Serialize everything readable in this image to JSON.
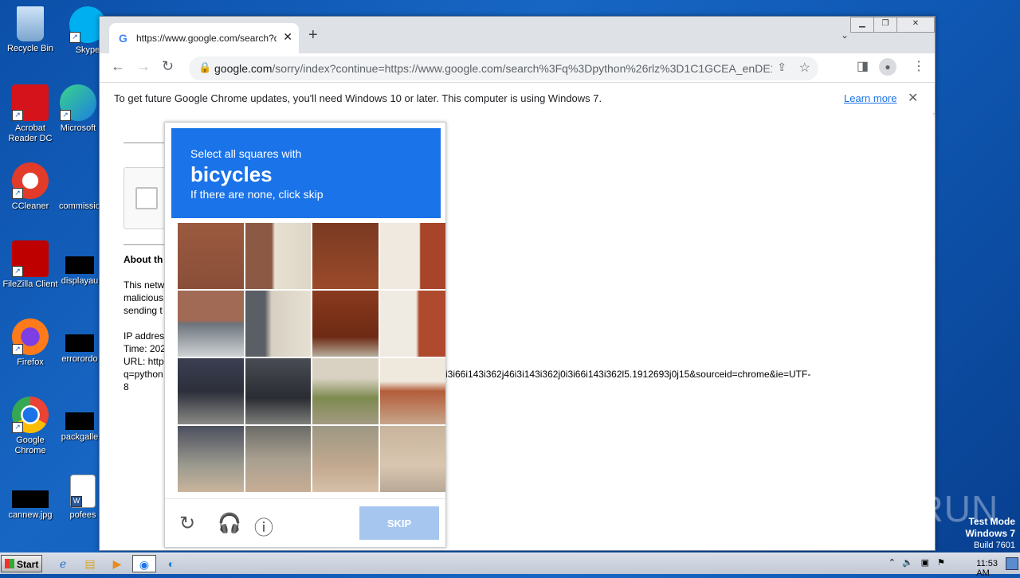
{
  "desktop": {
    "icons": [
      {
        "label": "Recycle Bin"
      },
      {
        "label": "Skype"
      },
      {
        "label": "Acrobat Reader DC"
      },
      {
        "label": "Microsoft"
      },
      {
        "label": "CCleaner"
      },
      {
        "label": "commissio"
      },
      {
        "label": "FileZilla Client"
      },
      {
        "label": "displayau"
      },
      {
        "label": "Firefox"
      },
      {
        "label": "errorordo"
      },
      {
        "label": "Google Chrome"
      },
      {
        "label": "packgalle"
      },
      {
        "label": "cannew.jpg"
      },
      {
        "label": "pofees"
      }
    ]
  },
  "browser": {
    "tab_title": "https://www.google.com/search?q=",
    "tab_close": "✕",
    "new_tab": "+",
    "url_domain": "google.com",
    "url_rest": "/sorry/index?continue=https://www.google.com/search%3Fq%3Dpython%26rlz%3D1C1GCEA_enDE1...",
    "infobar_message": "To get future Google Chrome updates, you'll need Windows 10 or later. This computer is using Windows 7.",
    "infobar_link": "Learn more"
  },
  "page": {
    "about_heading": "About th",
    "para_l1": "This netw",
    "para_l2": "malicious",
    "para_l3": "sending t",
    "ip_line": "IP addres",
    "time_line": "Time: 202",
    "url_line": "URL: http",
    "q_line": "q=python",
    "url_tail": "i3i66i143i362j46i3i143i362j0i3i66i143i362l5.1912693j0j15&sourceid=chrome&ie=UTF-",
    "url_tail2": "8"
  },
  "captcha": {
    "instruction": "Select all squares with",
    "target": "bicycles",
    "hint": "If there are none, click skip",
    "skip_label": "SKIP"
  },
  "taskbar": {
    "start_label": "Start",
    "clock": "11:53 AM"
  },
  "watermark": {
    "brand": "ANY RUN",
    "line1": "Test Mode",
    "line2": "Windows 7",
    "line3": "Build 7601"
  },
  "colors": {
    "captcha_blue": "#1a73e8",
    "skip_disabled": "#a7c6ef"
  }
}
